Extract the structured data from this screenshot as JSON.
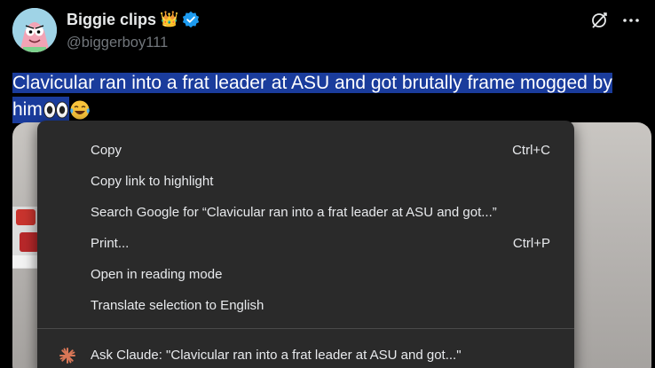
{
  "tweet": {
    "display_name": "Biggie clips",
    "crown_emoji": "👑",
    "handle": "@biggerboy111",
    "text_line1": "Clavicular ran into a frat leader at ASU and got brutally frame mogged by",
    "text_line2": "him",
    "colors": {
      "background": "#000000",
      "selection": "#1a3c9c",
      "verified": "#1d9bf0",
      "secondary_text": "#71767b"
    }
  },
  "context_menu": {
    "items": [
      {
        "label": "Copy",
        "shortcut": "Ctrl+C"
      },
      {
        "label": "Copy link to highlight",
        "shortcut": ""
      },
      {
        "label": "Search Google for “Clavicular ran into a frat leader at ASU and got...”",
        "shortcut": ""
      },
      {
        "label": "Print...",
        "shortcut": "Ctrl+P"
      },
      {
        "label": "Open in reading mode",
        "shortcut": ""
      },
      {
        "label": "Translate selection to English",
        "shortcut": ""
      }
    ],
    "extension_item": {
      "label": "Ask Claude: \"Clavicular ran into a frat leader at ASU and got...\"",
      "icon": "claude-sparkle-icon",
      "icon_color": "#d97757"
    },
    "colors": {
      "background": "#2a2a2a",
      "text": "#e8eaed"
    }
  },
  "icons": {
    "verified": "verified-badge-icon",
    "grok": "grok-icon",
    "more": "more-icon"
  }
}
